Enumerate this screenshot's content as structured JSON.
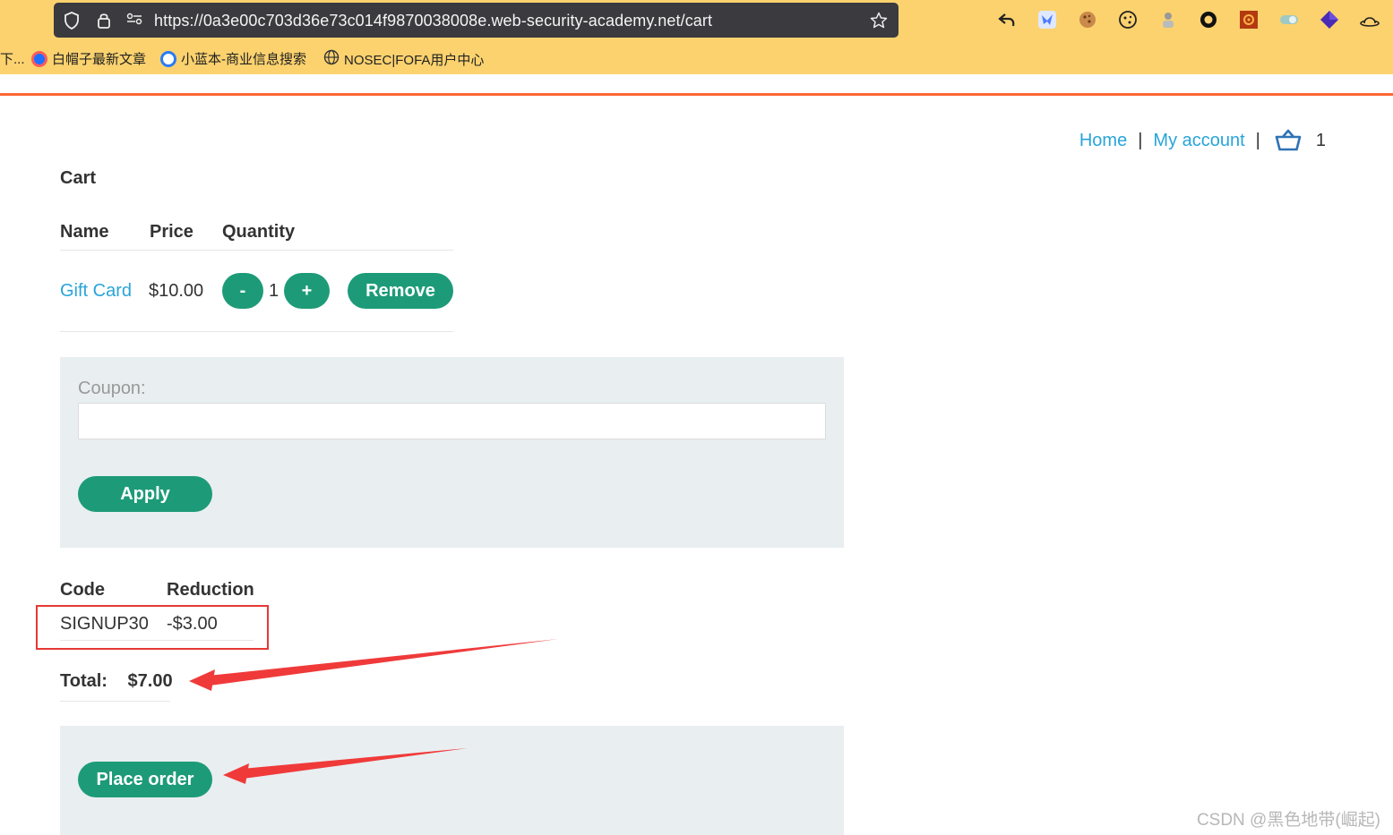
{
  "browser": {
    "url": "https://0a3e00c703d36e73c014f9870038008e.web-security-academy.net/cart",
    "bookmarks": [
      {
        "label": "下..."
      },
      {
        "label": "白帽子最新文章"
      },
      {
        "label": "小蓝本-商业信息搜索"
      },
      {
        "label": "NOSEC|FOFA用户中心"
      }
    ],
    "icons": [
      "shield-icon",
      "lock-icon",
      "permissions-icon",
      "star-icon",
      "back-icon",
      "bird-extension-icon",
      "cookie-extension-icon",
      "cookie-editor-icon",
      "wappalyzer-icon",
      "circle-extension-icon",
      "gear-extension-icon",
      "toggle-extension-icon",
      "cube-extension-icon",
      "hat-extension-icon"
    ]
  },
  "nav": {
    "home": "Home",
    "separator": "|",
    "my_account": "My account",
    "cart_count": "1"
  },
  "cart": {
    "heading": "Cart",
    "columns": [
      "Name",
      "Price",
      "Quantity"
    ],
    "items": [
      {
        "name": "Gift Card",
        "price": "$10.00",
        "quantity": "1",
        "minus": "-",
        "plus": "+",
        "remove": "Remove"
      }
    ]
  },
  "coupon": {
    "label": "Coupon:",
    "value": "",
    "placeholder": "",
    "apply": "Apply"
  },
  "discounts": {
    "columns": [
      "Code",
      "Reduction"
    ],
    "rows": [
      {
        "code": "SIGNUP30",
        "reduction": "-$3.00"
      }
    ]
  },
  "total": {
    "label": "Total:",
    "value": "$7.00"
  },
  "order": {
    "place_order": "Place order"
  },
  "annotations": {
    "highlight_color": "#e53935",
    "watermark": "CSDN @黑色地带(崛起)"
  },
  "colors": {
    "chrome": "#fbd26e",
    "accent": "#ff6633",
    "button": "#1d9b78",
    "link": "#29a4d9",
    "panel": "#e9eef1"
  }
}
